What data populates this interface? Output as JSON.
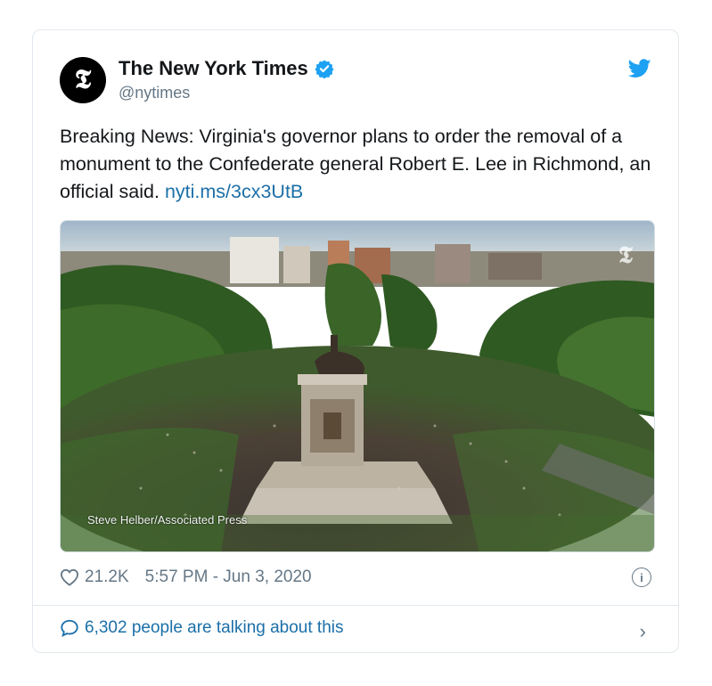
{
  "author": {
    "name": "The New York Times",
    "handle": "@nytimes",
    "avatar_glyph": "𝕿",
    "avatar_icon": "nyt-logo-icon",
    "verified_icon": "verified-badge-icon"
  },
  "platform_icon": "twitter-bird-icon",
  "tweet": {
    "text_before_link": "Breaking News: Virginia's governor plans to order the removal of a monument to the Confederate general Robert E. Lee in Richmond, an official said.",
    "link": "nyti.ms/3cx3UtB"
  },
  "photo": {
    "credit": "Steve Helber/Associated Press",
    "watermark_glyph": "𝕿"
  },
  "stats": {
    "likes": "21.2K",
    "timestamp": "5:57 PM - Jun 3, 2020",
    "info_glyph": "i"
  },
  "conversation": {
    "label": "6,302 people are talking about this",
    "chevron": "›"
  },
  "colors": {
    "link": "#1b6fa8",
    "twitter_blue": "#1da1f2",
    "muted": "#657786"
  }
}
